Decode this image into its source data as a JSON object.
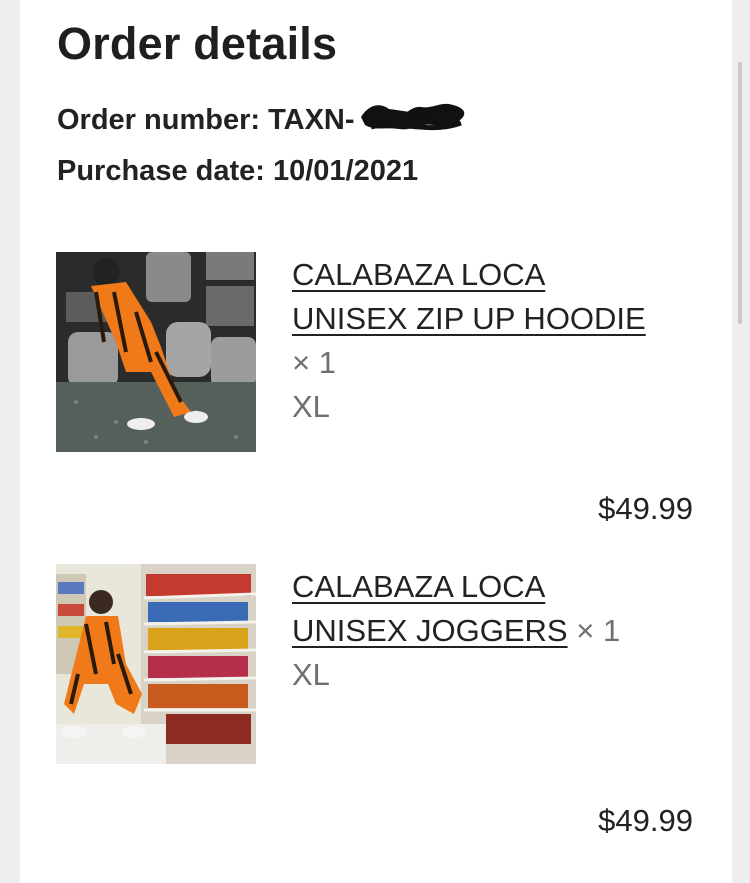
{
  "order": {
    "title": "Order details",
    "order_number_label": "Order number: TAXN-",
    "purchase_date_label": "Purchase date: 10/01/2021"
  },
  "items": [
    {
      "name_line1": "CALABAZA LOCA",
      "name_line2": "UNISEX ZIP UP HOODIE",
      "quantity": "× 1",
      "variant": "XL",
      "price": "$49.99"
    },
    {
      "name_line1": "CALABAZA LOCA",
      "name_line2": "UNISEX JOGGERS",
      "quantity": "× 1",
      "variant": "XL",
      "price": "$49.99"
    }
  ],
  "colors": {
    "outfit_orange": "#f07a1a",
    "background": "#eeeeef"
  }
}
